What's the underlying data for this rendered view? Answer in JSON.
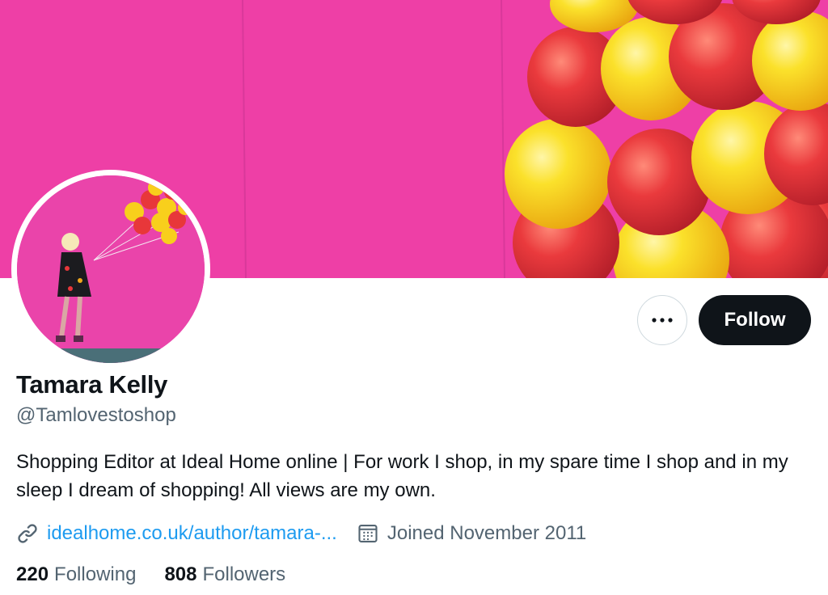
{
  "profile": {
    "name": "Tamara Kelly",
    "handle": "@Tamlovestoshop",
    "bio": "Shopping Editor at Ideal Home online | For work I shop, in my spare time I shop and in my sleep I dream of shopping! All views are my own.",
    "website": "idealhome.co.uk/author/tamara-...",
    "joined": "Joined November 2011"
  },
  "actions": {
    "more_label": "•••",
    "follow_label": "Follow"
  },
  "stats": {
    "following_count": "220",
    "following_label": "Following",
    "followers_count": "808",
    "followers_label": "Followers"
  },
  "icons": {
    "more": "more-dots-icon",
    "link": "link-icon",
    "calendar": "calendar-icon"
  },
  "colors": {
    "banner_bg": "#ee3fa6",
    "balloon_red": "#e8373a",
    "balloon_yellow": "#f8d21c",
    "follow_bg": "#0f1419",
    "link": "#1d9bf0",
    "muted": "#536471"
  }
}
